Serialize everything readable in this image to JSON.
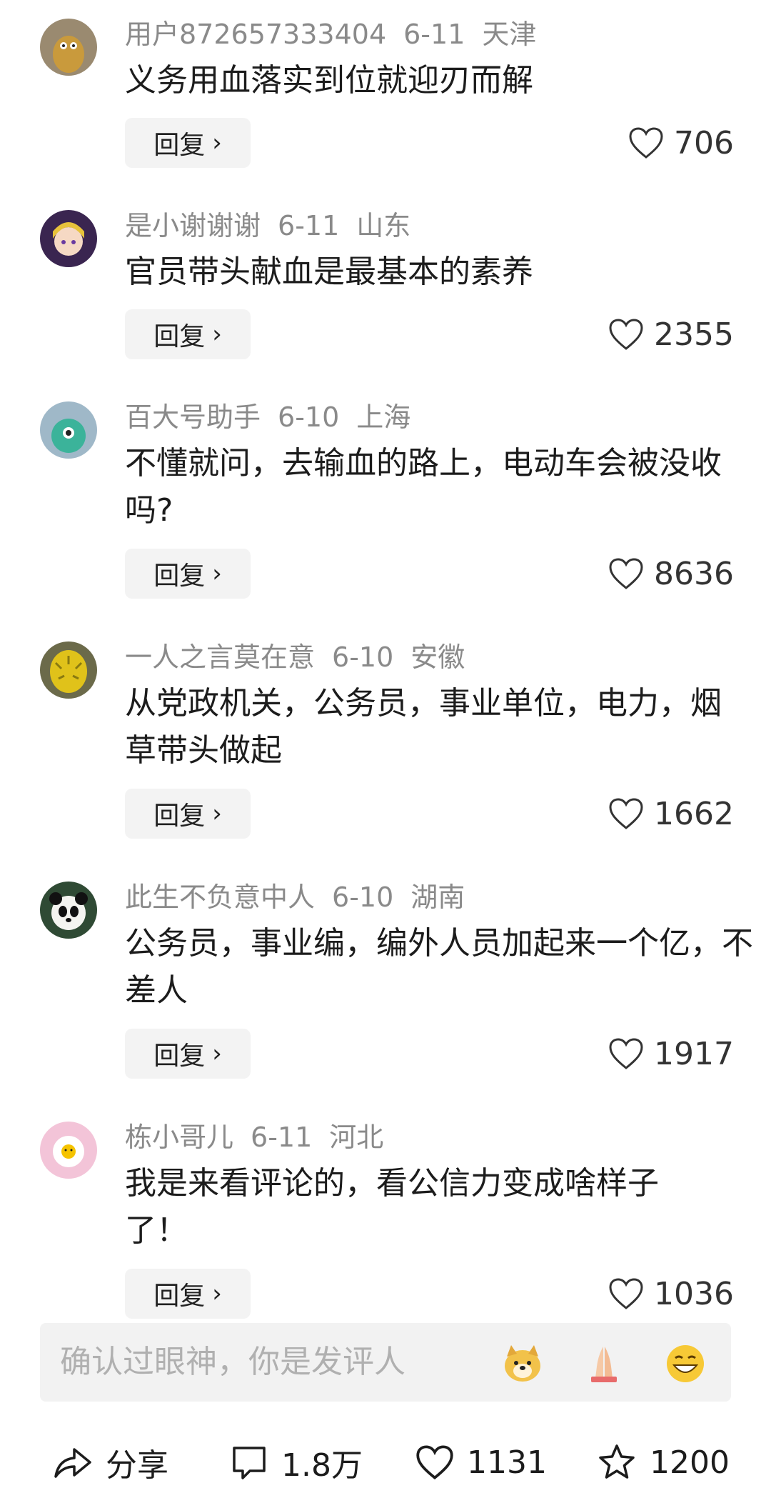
{
  "comments": [
    {
      "user": "用户872657333404",
      "date": "6-11",
      "location": "天津",
      "text": "义务用血落实到位就迎刃而解",
      "reply": "回复",
      "likes": "706"
    },
    {
      "user": "是小谢谢谢",
      "date": "6-11",
      "location": "山东",
      "text": "官员带头献血是最基本的素养",
      "reply": "回复",
      "likes": "2355"
    },
    {
      "user": "百大号助手",
      "date": "6-10",
      "location": "上海",
      "text": "不懂就问，去输血的路上，电动车会被没收吗?",
      "reply": "回复",
      "likes": "8636"
    },
    {
      "user": "一人之言莫在意",
      "date": "6-10",
      "location": "安徽",
      "text": "从党政机关，公务员，事业单位，电力，烟草带头做起",
      "reply": "回复",
      "likes": "1662"
    },
    {
      "user": "此生不负意中人",
      "date": "6-10",
      "location": "湖南",
      "text": "公务员，事业编，编外人员加起来一个亿，不差人",
      "reply": "回复",
      "likes": "1917"
    },
    {
      "user": "栋小哥儿",
      "date": "6-11",
      "location": "河北",
      "text": "我是来看评论的，看公信力变成啥样子了！",
      "reply": "回复",
      "likes": "1036"
    }
  ],
  "input": {
    "placeholder": "确认过眼神，你是发评人"
  },
  "emojis": [
    "dog-face-emoji",
    "praying-hands-emoji",
    "grinning-face-emoji"
  ],
  "bottom": {
    "share_label": "分享",
    "comment_count": "1.8万",
    "like_count": "1131",
    "fav_count": "1200"
  },
  "colors": {
    "meta": "#8a8a8a",
    "reply_bg": "#f3f3f3",
    "input_bg": "#f2f2f2"
  }
}
